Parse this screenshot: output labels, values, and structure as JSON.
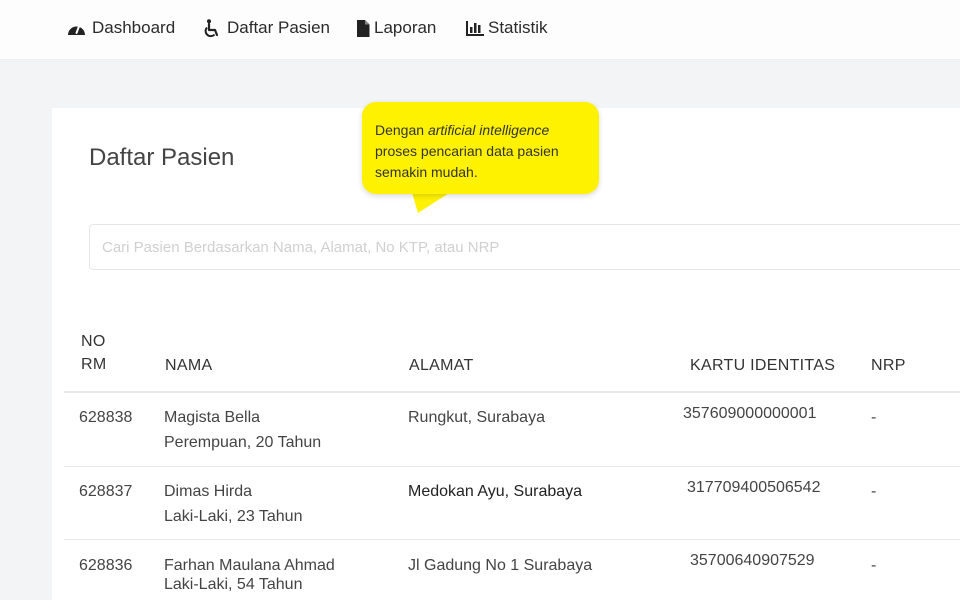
{
  "nav": {
    "items": [
      {
        "label": "Dashboard",
        "icon": "dashboard-gauge-icon"
      },
      {
        "label": "Daftar Pasien",
        "icon": "wheelchair-icon"
      },
      {
        "label": "Laporan",
        "icon": "document-icon"
      },
      {
        "label": "Statistik",
        "icon": "bar-chart-icon"
      }
    ]
  },
  "page": {
    "title": "Daftar Pasien"
  },
  "tooltip": {
    "prefix": "Dengan ",
    "emphasis": "artificial intelligence",
    "line2": "proses pencarian data pasien",
    "line3": "semakin mudah.",
    "color": "#fff200"
  },
  "search": {
    "placeholder": "Cari Pasien Berdasarkan Nama, Alamat, No KTP, atau NRP",
    "value": ""
  },
  "table": {
    "headers": {
      "no_rm_line1": "NO",
      "no_rm_line2": "RM",
      "nama": "NAMA",
      "alamat": "ALAMAT",
      "kartu": "KARTU IDENTITAS",
      "nrp": "NRP"
    },
    "rows": [
      {
        "no_rm": "628838",
        "nama": "Magista Bella",
        "info": "Perempuan, 20 Tahun",
        "alamat": "Rungkut, Surabaya",
        "kartu": "357609000000001",
        "nrp": "-"
      },
      {
        "no_rm": "628837",
        "nama": "Dimas Hirda",
        "info": "Laki-Laki, 23 Tahun",
        "alamat": "Medokan Ayu, Surabaya",
        "kartu": "317709400506542",
        "nrp": "-"
      },
      {
        "no_rm": "628836",
        "nama": "Farhan Maulana Ahmad",
        "info": "Laki-Laki, 54 Tahun",
        "alamat": "Jl Gadung No 1 Surabaya",
        "kartu": "35700640907529",
        "nrp": "-"
      }
    ]
  }
}
